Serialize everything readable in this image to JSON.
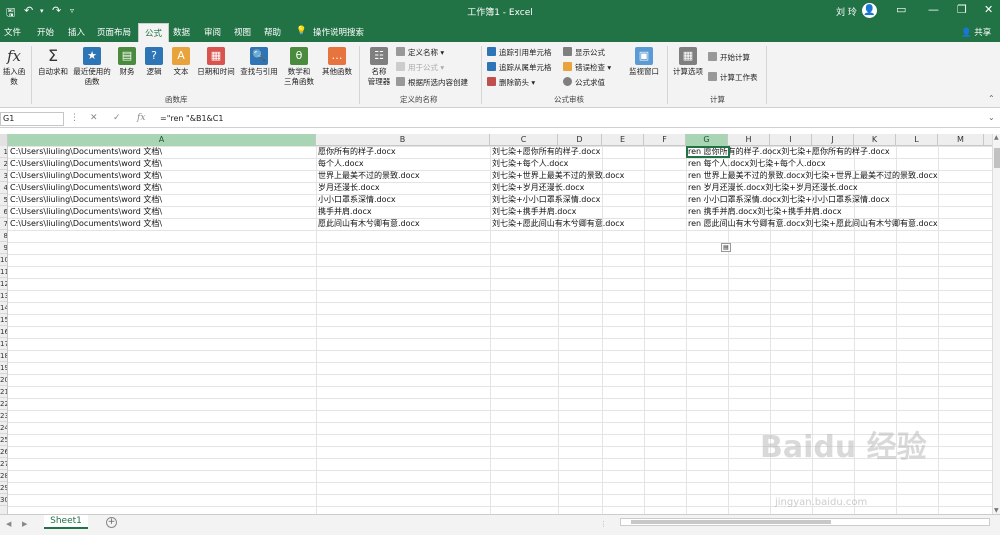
{
  "titlebar": {
    "title": "工作簿1 - Excel",
    "user": "刘 玲",
    "avatar": "👤"
  },
  "tabs": [
    "文件",
    "开始",
    "插入",
    "页面布局",
    "公式",
    "数据",
    "审阅",
    "视图",
    "帮助",
    "操作说明搜索"
  ],
  "share": "共享",
  "ribbon": {
    "insert_fn": "插入函数",
    "autosum": "自动求和",
    "recent": "最近使用的",
    "recent2": "函数",
    "finance": "财务",
    "logic": "逻辑",
    "text": "文本",
    "datetime": "日期和时间",
    "lookup": "查找与引用",
    "math": "数学和",
    "math2": "三角函数",
    "more": "其他函数",
    "group_lib": "函数库",
    "namemgr": "名称",
    "namemgr2": "管理器",
    "define_name": "定义名称",
    "use_in_formula": "用于公式",
    "create_from_sel": "根据所选内容创建",
    "group_names": "定义的名称",
    "trace_prec": "追踪引用单元格",
    "trace_dep": "追踪从属单元格",
    "remove_arrows": "删除箭头",
    "show_formulas": "显示公式",
    "error_check": "错误检查",
    "eval_formula": "公式求值",
    "watch": "监视窗口",
    "group_audit": "公式审核",
    "calc_opts": "计算选项",
    "calc_now": "开始计算",
    "calc_sheet": "计算工作表",
    "group_calc": "计算"
  },
  "formula_bar": {
    "name_box": "G1",
    "formula": "=\"ren \"&B1&C1"
  },
  "columns": [
    "A",
    "B",
    "C",
    "D",
    "E",
    "F",
    "G",
    "H",
    "I",
    "J",
    "K",
    "L",
    "M"
  ],
  "rows": [
    {
      "a": "C:\\Users\\liuling\\Documents\\word 文档\\",
      "b": "愿你所有的样子.docx",
      "c": "刘七染+愿你所有的样子.docx",
      "g": "ren 愿你所有的样子.docx刘七染+愿你所有的样子.docx"
    },
    {
      "a": "C:\\Users\\liuling\\Documents\\word 文档\\",
      "b": "每个人.docx",
      "c": "刘七染+每个人.docx",
      "g": "ren 每个人.docx刘七染+每个人.docx"
    },
    {
      "a": "C:\\Users\\liuling\\Documents\\word 文档\\",
      "b": "世界上最美不过的景致.docx",
      "c": "刘七染+世界上最美不过的景致.docx",
      "g": "ren 世界上最美不过的景致.docx刘七染+世界上最美不过的景致.docx"
    },
    {
      "a": "C:\\Users\\liuling\\Documents\\word 文档\\",
      "b": "岁月还漫长.docx",
      "c": "刘七染+岁月还漫长.docx",
      "g": "ren 岁月还漫长.docx刘七染+岁月还漫长.docx"
    },
    {
      "a": "C:\\Users\\liuling\\Documents\\word 文档\\",
      "b": "小小口罩系深情.docx",
      "c": "刘七染+小小口罩系深情.docx",
      "g": "ren 小小口罩系深情.docx刘七染+小小口罩系深情.docx"
    },
    {
      "a": "C:\\Users\\liuling\\Documents\\word 文档\\",
      "b": "携手并肩.docx",
      "c": "刘七染+携手并肩.docx",
      "g": "ren 携手并肩.docx刘七染+携手并肩.docx"
    },
    {
      "a": "C:\\Users\\liuling\\Documents\\word 文档\\",
      "b": "愿此间山有木兮卿有意.docx",
      "c": "刘七染+愿此间山有木兮卿有意.docx",
      "g": "ren 愿此间山有木兮卿有意.docx刘七染+愿此间山有木兮卿有意.docx"
    }
  ],
  "row_numbers": [
    "1",
    "2",
    "3",
    "4",
    "5",
    "6",
    "7",
    "8",
    "9",
    "10",
    "11",
    "12",
    "13",
    "14",
    "15",
    "16",
    "17",
    "18",
    "19",
    "20",
    "21",
    "22",
    "23",
    "24",
    "25",
    "26",
    "27",
    "28",
    "29",
    "30"
  ],
  "sheet": {
    "tab": "Sheet1",
    "add": "+"
  },
  "watermark": {
    "brand": "Baidu 经验",
    "url": "jingyan.baidu.com"
  },
  "colors": {
    "excel_green": "#217346",
    "selected_header": "#a9d5b5"
  }
}
